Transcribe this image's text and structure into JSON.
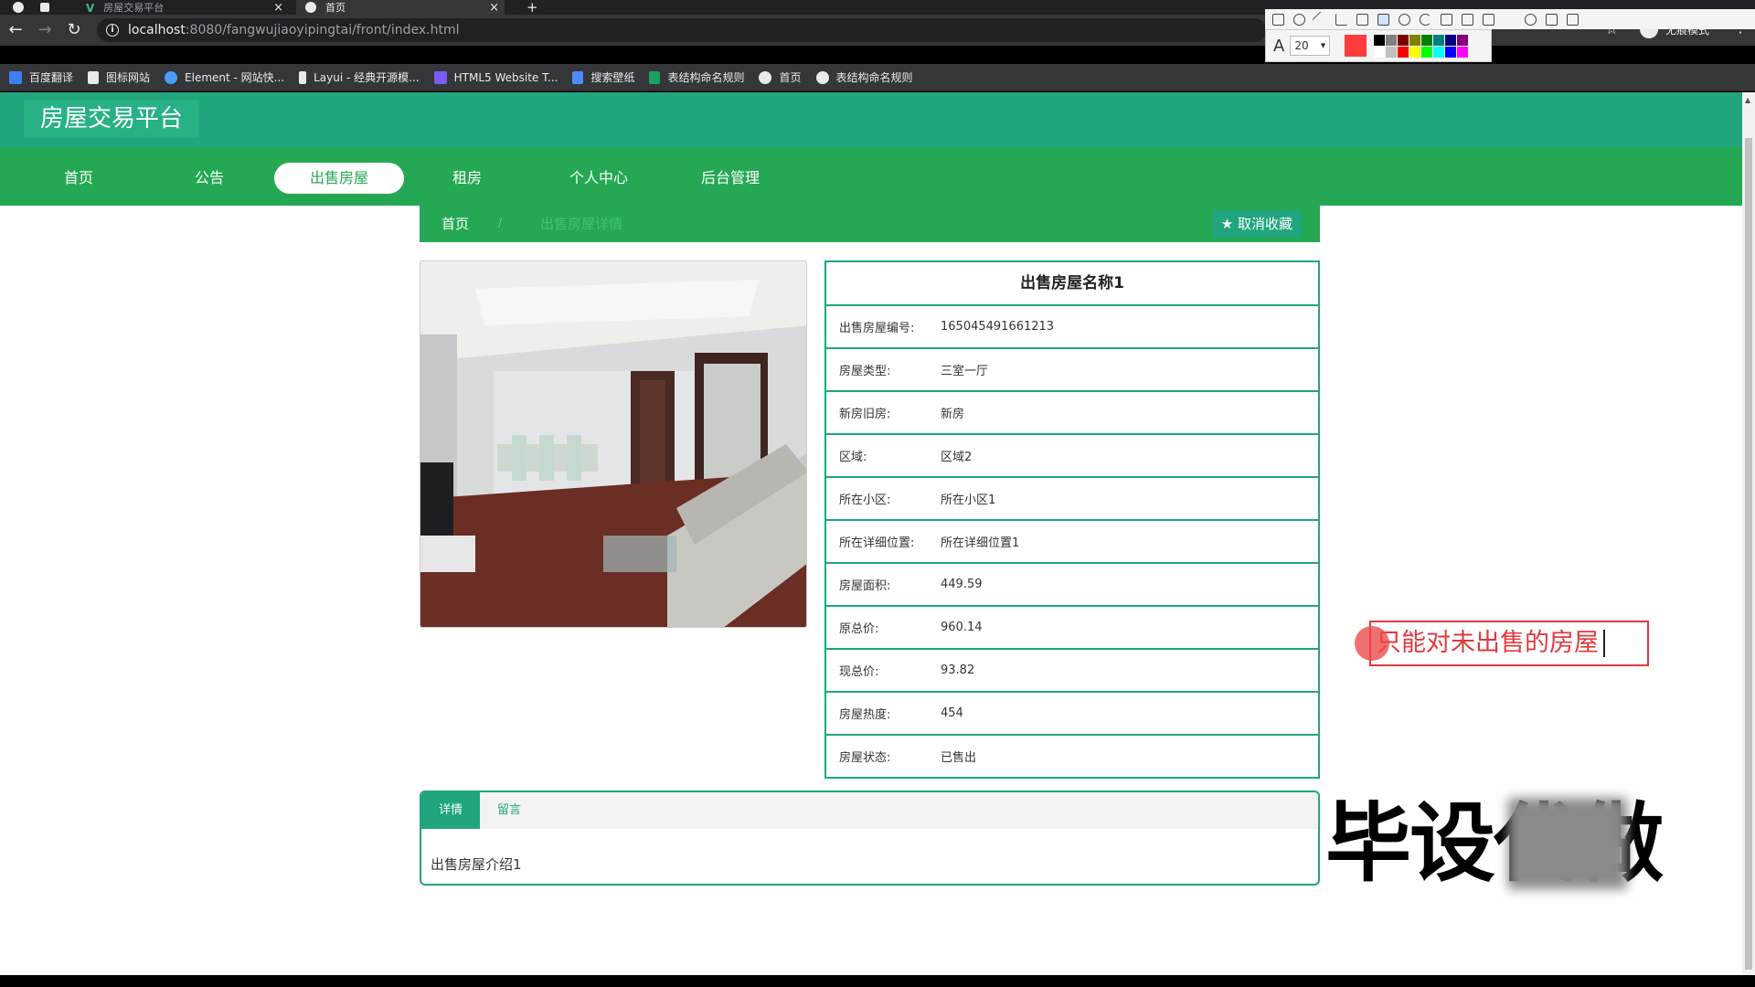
{
  "browser": {
    "tabs": [
      {
        "title": "房屋交易平台",
        "active": false
      },
      {
        "title": "首页",
        "active": true
      }
    ],
    "new_tab": "+",
    "url_host": "localhost",
    "url_path": ":8080/fangwujiaoyipingtai/front/index.html",
    "incognito_label": "无痕模式",
    "bookmarks": [
      "百度翻译",
      "图标网站",
      "Element - 网站快...",
      "Layui - 经典开源模...",
      "HTML5 Website T...",
      "搜索壁纸",
      "表结构命名规则",
      "首页",
      "表结构命名规则"
    ]
  },
  "drawing_tool": {
    "font_size": "20",
    "current_color": "#ff3b3b",
    "palette": [
      "#000000",
      "#808080",
      "#800000",
      "#808000",
      "#008000",
      "#008080",
      "#000080",
      "#800080",
      "#ffffff",
      "#c0c0c0",
      "#ff0000",
      "#ffff00",
      "#00ff00",
      "#00ffff",
      "#0000ff",
      "#ff00ff"
    ]
  },
  "site": {
    "title": "房屋交易平台",
    "nav": [
      "首页",
      "公告",
      "出售房屋",
      "租房",
      "个人中心",
      "后台管理"
    ],
    "nav_active_index": 2,
    "breadcrumb": {
      "home": "首页",
      "separator": "/",
      "current": "出售房屋详情"
    },
    "favorite_button": "取消收藏"
  },
  "house": {
    "name": "出售房屋名称1",
    "rows": [
      {
        "label": "出售房屋编号:",
        "value": "165045491661213"
      },
      {
        "label": "房屋类型:",
        "value": "三室一厅"
      },
      {
        "label": "新房旧房:",
        "value": "新房"
      },
      {
        "label": "区域:",
        "value": "区域2"
      },
      {
        "label": "所在小区:",
        "value": "所在小区1"
      },
      {
        "label": "所在详细位置:",
        "value": "所在详细位置1"
      },
      {
        "label": "房屋面积:",
        "value": "449.59"
      },
      {
        "label": "原总价:",
        "value": "960.14"
      },
      {
        "label": "现总价:",
        "value": "93.82"
      },
      {
        "label": "房屋热度:",
        "value": "454"
      },
      {
        "label": "房屋状态:",
        "value": "已售出"
      }
    ]
  },
  "detail_tabs": {
    "tabs": [
      "详情",
      "留言"
    ],
    "active_index": 0,
    "content": "出售房屋介绍1"
  },
  "annotation": {
    "text": "只能对未出售的房屋"
  },
  "watermark": {
    "text": "毕设代做"
  }
}
